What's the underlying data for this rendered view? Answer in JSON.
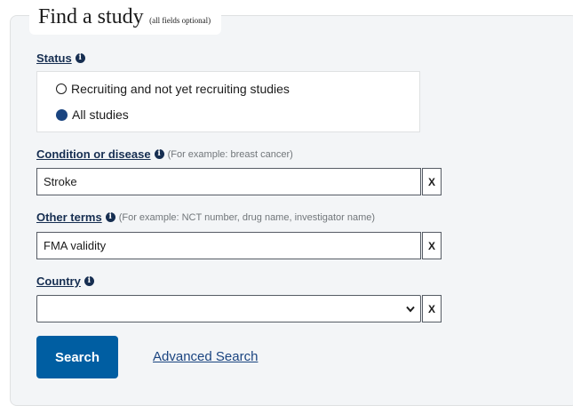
{
  "form": {
    "title": "Find a study",
    "title_note": "(all fields optional)"
  },
  "status": {
    "label": "Status",
    "options": [
      {
        "label": "Recruiting and not yet recruiting studies",
        "selected": false
      },
      {
        "label": "All studies",
        "selected": true
      }
    ]
  },
  "condition": {
    "label": "Condition or disease",
    "hint": "(For example: breast cancer)",
    "value": "Stroke",
    "clear_label": "X"
  },
  "other_terms": {
    "label": "Other terms",
    "hint": "(For example: NCT number, drug name, investigator name)",
    "value": "FMA validity",
    "clear_label": "X"
  },
  "country": {
    "label": "Country",
    "value": "",
    "clear_label": "X"
  },
  "actions": {
    "search_label": "Search",
    "advanced_label": "Advanced Search"
  },
  "colors": {
    "primary_button": "#005ea2",
    "label_color": "#162e51",
    "link_color": "#1a4480",
    "panel_bg": "#f3f5f7"
  },
  "icons": {
    "info": "info-icon",
    "select_arrow": "chevron-down-icon"
  }
}
